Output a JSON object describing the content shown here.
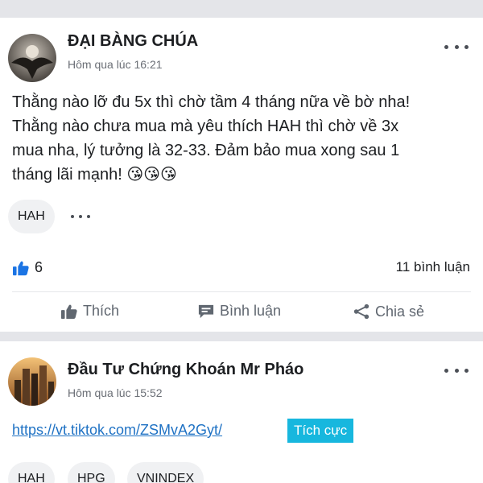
{
  "posts": [
    {
      "author": "ĐẠI BÀNG CHÚA",
      "time": "Hôm qua lúc 16:21",
      "content": [
        "Thằng nào lỡ đu 5x thì chờ tầm 4 tháng nữa về bờ nha!",
        "Thằng nào chưa mua mà yêu thích HAH thì chờ về 3x",
        "mua nha, lý tưởng là 32-33. Đảm bảo mua xong sau 1",
        "tháng lãi mạnh! 😘😘😘"
      ],
      "tags": [
        "HAH"
      ],
      "likes": "6",
      "comments": "11 bình luận",
      "actions": {
        "like": "Thích",
        "comment": "Bình luận",
        "share": "Chia sẻ"
      }
    },
    {
      "author": "Đầu Tư Chứng Khoán Mr Pháo",
      "time": "Hôm qua lúc 15:52",
      "link": "https://vt.tiktok.com/ZSMvA2Gyt/",
      "badge": "Tích cực",
      "tags": [
        "HAH",
        "HPG",
        "VNINDEX"
      ]
    }
  ],
  "icons": {
    "more": "more-horizontal-icon",
    "like": "thumbs-up-icon",
    "comment": "comment-icon",
    "share": "share-icon"
  },
  "colors": {
    "link": "#1f72c4",
    "badge": "#17b7de",
    "like_icon": "#1b74e4"
  }
}
